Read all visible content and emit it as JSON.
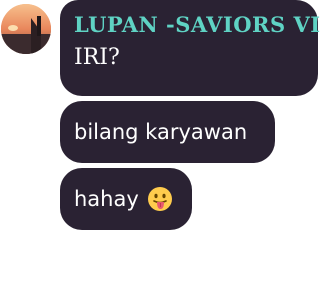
{
  "messages": [
    {
      "sender": "LUPAN -SAVIORS VI",
      "text": "IRI?"
    },
    {
      "text": "bilang karyawan"
    },
    {
      "text": "hahay",
      "emoji_icon": "face-with-tongue-icon"
    }
  ],
  "colors": {
    "bubble_bg": "#2a2233",
    "sender_name": "#5fd3c4",
    "message_text": "#ffffff"
  }
}
